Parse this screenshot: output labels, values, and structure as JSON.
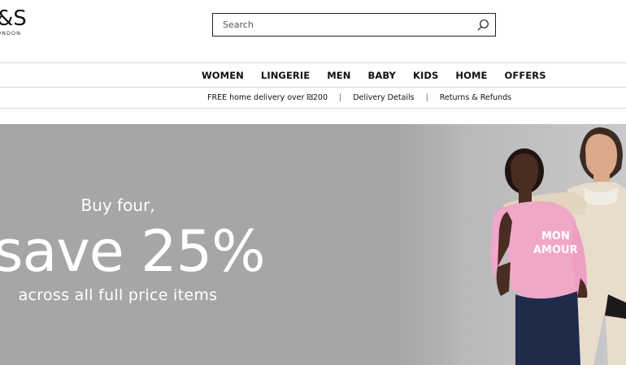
{
  "logo": {
    "main": "&S",
    "sub": "ONDON"
  },
  "search": {
    "placeholder": "Search"
  },
  "nav": {
    "items": [
      "WOMEN",
      "LINGERIE",
      "MEN",
      "BABY",
      "KIDS",
      "HOME",
      "OFFERS"
    ]
  },
  "info": {
    "delivery": "FREE home delivery over ₪200",
    "details": "Delivery Details",
    "returns": "Returns & Refunds"
  },
  "hero": {
    "line1": "Buy four,",
    "line2": "save 25%",
    "line3": "across all full price items",
    "shirt_text_1": "MON",
    "shirt_text_2": "AMOUR"
  },
  "colors": {
    "hero_bg": "#a6a6a6",
    "sweater": "#f1a7c8",
    "jeans": "#1f2b4a",
    "text_dark": "#111111"
  }
}
